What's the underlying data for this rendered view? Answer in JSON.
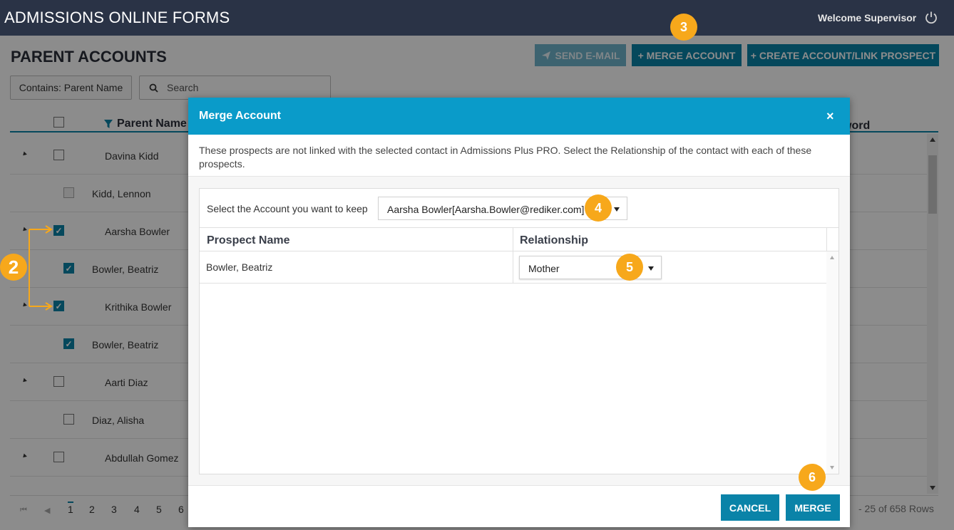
{
  "app": {
    "title_bold": "ADMISSIONS",
    "title_rest": " ONLINE FORMS",
    "welcome": "Welcome Supervisor"
  },
  "page": {
    "title": "PARENT ACCOUNTS",
    "buttons": {
      "send_email": "SEND E-MAIL",
      "merge_account": "+ MERGE ACCOUNT",
      "create_account": "+ CREATE ACCOUNT/LINK PROSPECT"
    },
    "filter_label": "Contains: Parent Name",
    "search_placeholder": "Search"
  },
  "grid": {
    "columns": {
      "parent_name": "Parent Name",
      "password_partial": "word"
    },
    "rows": [
      {
        "name": "Davina Kidd",
        "level": "parent",
        "checked": false
      },
      {
        "name": "Kidd, Lennon",
        "level": "child",
        "checked": false
      },
      {
        "name": "Aarsha Bowler",
        "level": "parent",
        "checked": true
      },
      {
        "name": "Bowler, Beatriz",
        "level": "child",
        "checked": true
      },
      {
        "name": "Krithika Bowler",
        "level": "parent",
        "checked": true
      },
      {
        "name": "Bowler, Beatriz",
        "level": "child",
        "checked": true
      },
      {
        "name": "Aarti Diaz",
        "level": "parent",
        "checked": false
      },
      {
        "name": "Diaz, Alisha",
        "level": "child",
        "checked": false
      },
      {
        "name": "Abdullah Gomez",
        "level": "parent",
        "checked": false
      }
    ]
  },
  "pager": {
    "pages": [
      "1",
      "2",
      "3",
      "4",
      "5",
      "6"
    ],
    "current": "1",
    "rows_info": "- 25 of 658 Rows"
  },
  "modal": {
    "title": "Merge Account",
    "close": "×",
    "description": "These prospects are not linked with the selected contact in Admissions Plus PRO. Select the Relationship of the contact with each of these prospects.",
    "keep_label": "Select the Account you want to keep",
    "keep_value": "Aarsha Bowler[Aarsha.Bowler@rediker.com]",
    "table": {
      "col_prospect": "Prospect Name",
      "col_relationship": "Relationship",
      "rows": [
        {
          "prospect": "Bowler, Beatriz",
          "relationship": "Mother"
        }
      ]
    },
    "cancel": "CANCEL",
    "merge": "MERGE"
  },
  "annotations": {
    "step2": "2",
    "step3": "3",
    "step4": "4",
    "step5": "5",
    "step6": "6",
    "color": "#f7a81b"
  },
  "colors": {
    "topbar": "#2a3346",
    "primary": "#0a83a8",
    "modal_header": "#0a9bc9"
  }
}
